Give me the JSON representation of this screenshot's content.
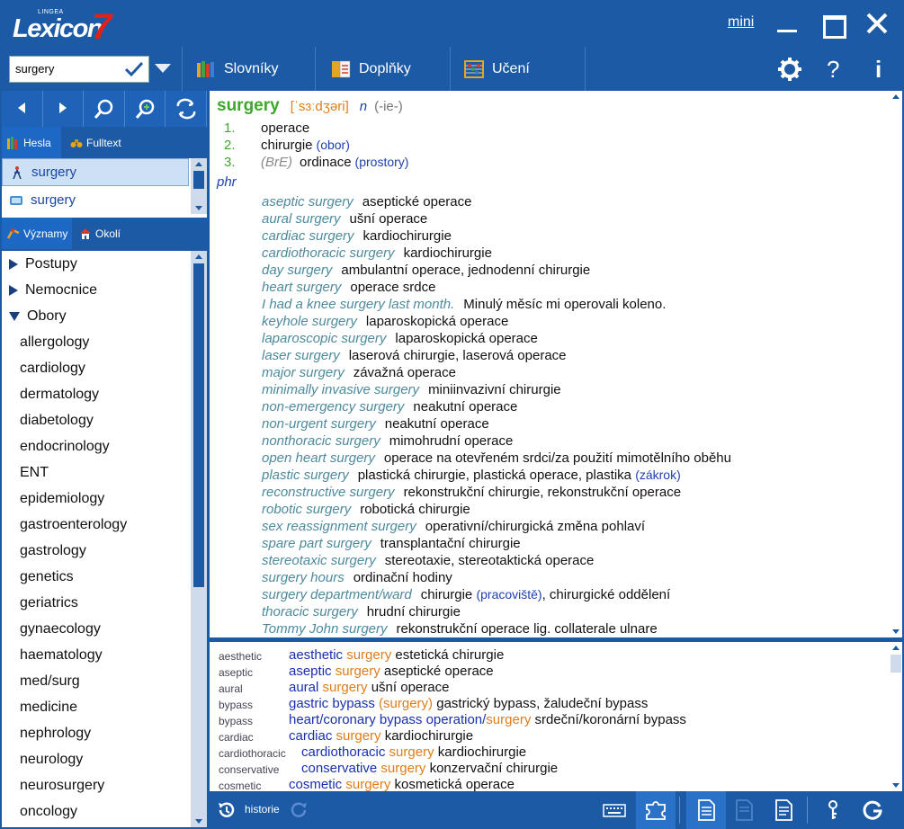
{
  "app": {
    "brand_small": "LINGEA",
    "brand_main": "Lexicon",
    "brand_num": "7",
    "mini_label": "mini"
  },
  "toolbar": {
    "search_value": "surgery",
    "slovniky": "Slovníky",
    "doplnky": "Doplňky",
    "uceni": "Učení",
    "help": "?",
    "info": "i"
  },
  "left": {
    "tabs1": [
      "Hesla",
      "Fulltext"
    ],
    "headwords": [
      "surgery",
      "surgery"
    ],
    "tabs2": [
      "Významy",
      "Okolí"
    ],
    "tree_groups": [
      "Postupy",
      "Nemocnice",
      "Obory"
    ],
    "tree_leaves": [
      "allergology",
      "cardiology",
      "dermatology",
      "diabetology",
      "endocrinology",
      "ENT",
      "epidemiology",
      "gastroenterology",
      "gastrology",
      "genetics",
      "geriatrics",
      "gynaecology",
      "haematology",
      "med/surg",
      "medicine",
      "nephrology",
      "neurology",
      "neurosurgery",
      "oncology"
    ]
  },
  "entry": {
    "headword": "surgery",
    "pron": "[ˈsɜːdʒəri]",
    "pos": "n",
    "gram": "(-ie-)",
    "senses": [
      {
        "num": "1.",
        "label": "",
        "tr": "operace",
        "note": ""
      },
      {
        "num": "2.",
        "label": "",
        "tr": "chirurgie",
        "note": "(obor)"
      },
      {
        "num": "3.",
        "label": "(BrE)",
        "tr": "ordinace",
        "note": "(prostory)"
      }
    ],
    "phr_label": "phr",
    "phrases": [
      {
        "en": "aseptic surgery",
        "cz": "aseptické operace"
      },
      {
        "en": "aural surgery",
        "cz": "ušní operace"
      },
      {
        "en": "cardiac surgery",
        "cz": "kardiochirurgie"
      },
      {
        "en": "cardiothoracic surgery",
        "cz": "kardiochirurgie"
      },
      {
        "en": "day surgery",
        "cz": "ambulantní operace, jednodenní chirurgie"
      },
      {
        "en": "heart surgery",
        "cz": "operace srdce"
      },
      {
        "en": "I had a knee surgery last month.",
        "cz": "Minulý měsíc mi operovali koleno."
      },
      {
        "en": "keyhole surgery",
        "cz": "laparoskopická operace"
      },
      {
        "en": "laparoscopic surgery",
        "cz": "laparoskopická operace"
      },
      {
        "en": "laser surgery",
        "cz": "laserová chirurgie, laserová operace"
      },
      {
        "en": "major surgery",
        "cz": "závažná operace"
      },
      {
        "en": "minimally invasive surgery",
        "cz": "miniinvazivní chirurgie"
      },
      {
        "en": "non-emergency surgery",
        "cz": "neakutní operace"
      },
      {
        "en": "non-urgent surgery",
        "cz": "neakutní operace"
      },
      {
        "en": "nonthoracic surgery",
        "cz": "mimohrudní operace"
      },
      {
        "en": "open heart surgery",
        "cz": "operace na otevřeném srdci/za použití mimotělního oběhu"
      },
      {
        "en": "plastic surgery",
        "cz": "plastická chirurgie, plastická operace, plastika ",
        "note": "(zákrok)"
      },
      {
        "en": "reconstructive surgery",
        "cz": "rekonstrukční chirurgie, rekonstrukční operace"
      },
      {
        "en": "robotic surgery",
        "cz": "robotická chirurgie"
      },
      {
        "en": "sex reassignment surgery",
        "cz": "operativní/chirurgická změna pohlaví"
      },
      {
        "en": "spare part surgery",
        "cz": "transplantační chirurgie"
      },
      {
        "en": "stereotaxic surgery",
        "cz": "stereotaxie, stereotaktická operace"
      },
      {
        "en": "surgery hours",
        "cz": "ordinační hodiny"
      },
      {
        "en": "surgery department/ward",
        "cz": "chirurgie ",
        "note": "(pracoviště)",
        "cz2": ", chirurgické oddělení"
      },
      {
        "en": "thoracic surgery",
        "cz": "hrudní chirurgie"
      },
      {
        "en": "Tommy John surgery",
        "cz": "rekonstrukční operace lig. collaterale ulnare"
      }
    ]
  },
  "lower": [
    {
      "key": "aesthetic",
      "a": "aesthetic",
      "b": " surgery",
      "c": "",
      "cz": "estetická chirurgie"
    },
    {
      "key": "aseptic",
      "a": "aseptic",
      "b": " surgery",
      "c": "",
      "cz": "aseptické operace"
    },
    {
      "key": "aural",
      "a": "aural",
      "b": " surgery",
      "c": "",
      "cz": "ušní operace"
    },
    {
      "key": "bypass",
      "a": "gastric bypass",
      "b": " (surgery)",
      "c": "",
      "cz": "gastrický bypass, žaludeční bypass"
    },
    {
      "key": "bypass",
      "a": "heart/coronary bypass operation/",
      "b": "surgery",
      "c": "",
      "cz": "srdeční/koronární bypass"
    },
    {
      "key": "cardiac",
      "a": "cardiac",
      "b": " surgery",
      "c": "",
      "cz": "kardiochirurgie"
    },
    {
      "key": "cardiothoracic",
      "a": "cardiothoracic",
      "b": " surgery",
      "c": "",
      "cz": "kardiochirurgie"
    },
    {
      "key": "conservative",
      "a": "conservative",
      "b": " surgery",
      "c": "",
      "cz": "konzervační chirurgie"
    },
    {
      "key": "cosmetic",
      "a": "cosmetic",
      "b": " surgery",
      "c": "",
      "cz": "kosmetická operace"
    }
  ],
  "bottom": {
    "history_label": "historie"
  },
  "colors": {
    "chrome_blue": "#1c5aa6",
    "headword_green": "#3da82c",
    "pron_orange": "#e07d1a",
    "phrase_teal": "#4d8a9c",
    "logo_red": "#e32017"
  }
}
